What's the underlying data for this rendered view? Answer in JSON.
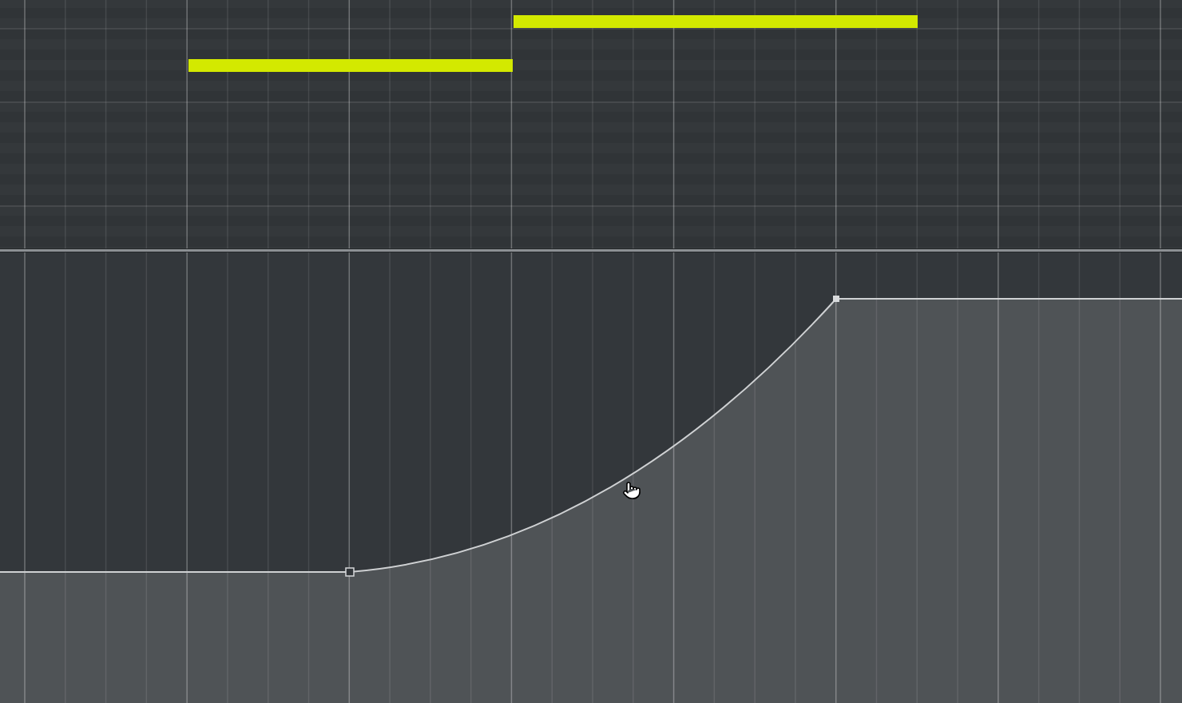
{
  "panes": [
    {
      "kind": "piano_roll"
    },
    {
      "kind": "automation"
    }
  ]
}
